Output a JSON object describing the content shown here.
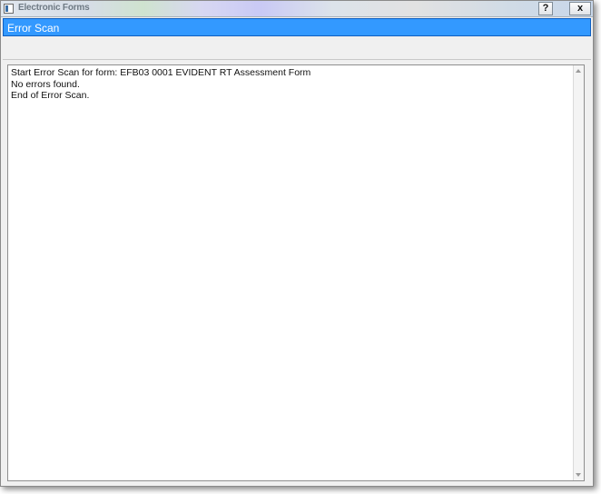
{
  "window": {
    "title": "Electronic Forms",
    "help_label": "?",
    "close_label": "x"
  },
  "header": {
    "label": "Error Scan"
  },
  "log": {
    "lines": [
      "Start Error Scan for form: EFB03 0001 EVIDENT RT Assessment Form",
      "No errors found.",
      "End of Error Scan."
    ]
  },
  "icons": {
    "app": "form-icon",
    "help": "question-mark-icon",
    "close": "close-icon",
    "scroll_up": "up-arrow-icon",
    "scroll_down": "down-arrow-icon"
  },
  "colors": {
    "header_background": "#3399ff",
    "header_text": "#ffffff"
  }
}
